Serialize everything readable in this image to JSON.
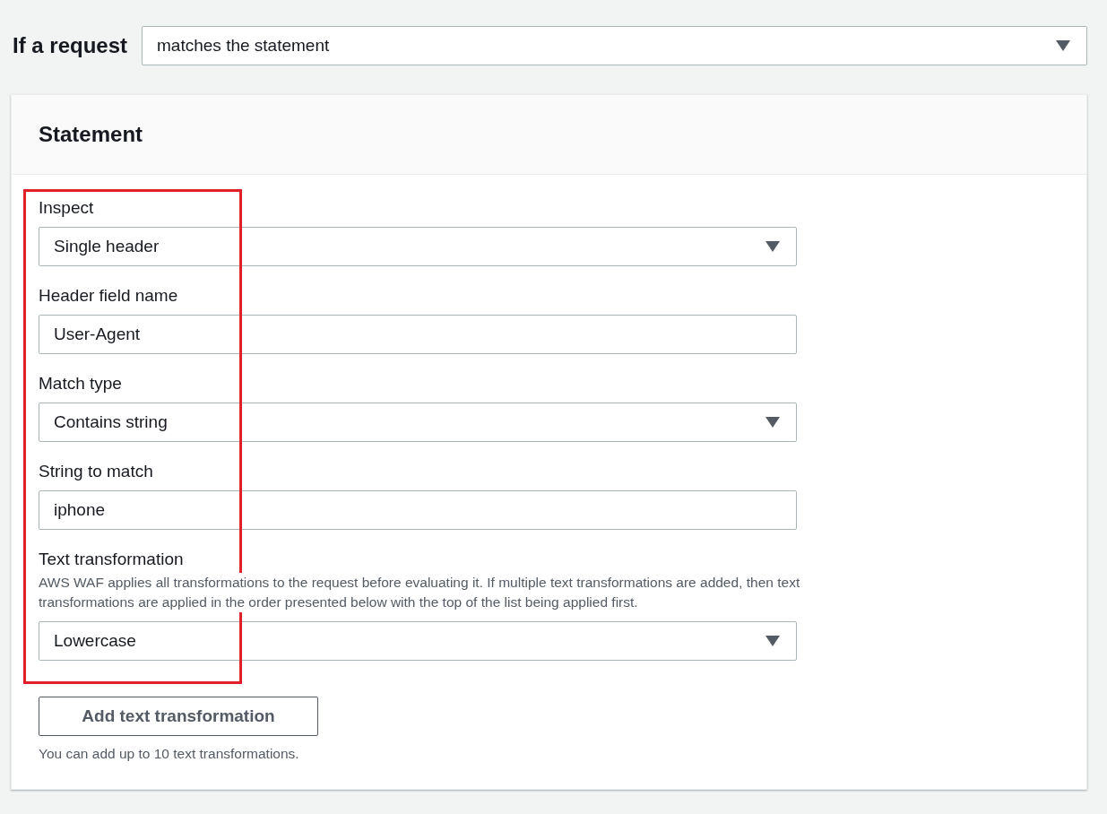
{
  "condition": {
    "label": "If a request",
    "value": "matches the statement"
  },
  "statement": {
    "title": "Statement",
    "fields": [
      {
        "kind": "select",
        "label": "Inspect",
        "value": "Single header"
      },
      {
        "kind": "text",
        "label": "Header field name",
        "value": "User-Agent"
      },
      {
        "kind": "select",
        "label": "Match type",
        "value": "Contains string"
      },
      {
        "kind": "text",
        "label": "String to match",
        "value": "iphone"
      },
      {
        "kind": "select",
        "label": "Text transformation",
        "description": "AWS WAF applies all transformations to the request before evaluating it. If multiple text transformations are added, then text transformations are applied in the order presented below with the top of the list being applied first.",
        "value": "Lowercase"
      }
    ],
    "add_button": "Add text transformation",
    "hint": "You can add up to 10 text transformations."
  }
}
